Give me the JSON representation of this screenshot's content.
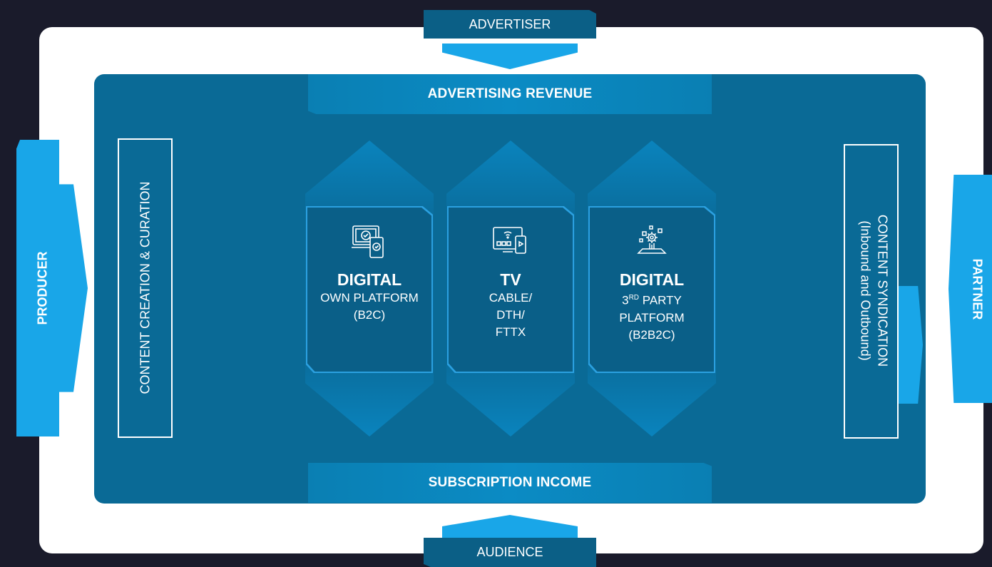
{
  "advertiser_label": "ADVERTISER",
  "audience_label": "AUDIENCE",
  "producer_label": "PRODUCER",
  "partner_label": "PARTNER",
  "advertising_revenue": "ADVERTISING REVENUE",
  "subscription_income": "SUBSCRIPTION INCOME",
  "left_box_label": "CONTENT CREATION & CURATION",
  "right_box_label_1": "CONTENT SYNDICATION",
  "right_box_label_2": "(Inbound and Outbound)",
  "cards": [
    {
      "icon": "devices-check-icon",
      "title": "DIGITAL",
      "lines": [
        "OWN PLATFORM",
        "(B2C)"
      ]
    },
    {
      "icon": "tv-wifi-icon",
      "title": "TV",
      "lines": [
        "CABLE/",
        "DTH/",
        "FTTX"
      ]
    },
    {
      "icon": "cloud-gears-icon",
      "title": "DIGITAL",
      "line1_main": "3",
      "line1_sup": "RD",
      "line1_rest": " PARTY",
      "lines": [
        "PLATFORM",
        "(B2B2C)"
      ]
    }
  ],
  "colors": {
    "background": "#1a1b2b",
    "panel": "#0a6a96",
    "accent": "#19a6e8",
    "card": "#0a5f88",
    "card_border": "#2ba0e0"
  }
}
